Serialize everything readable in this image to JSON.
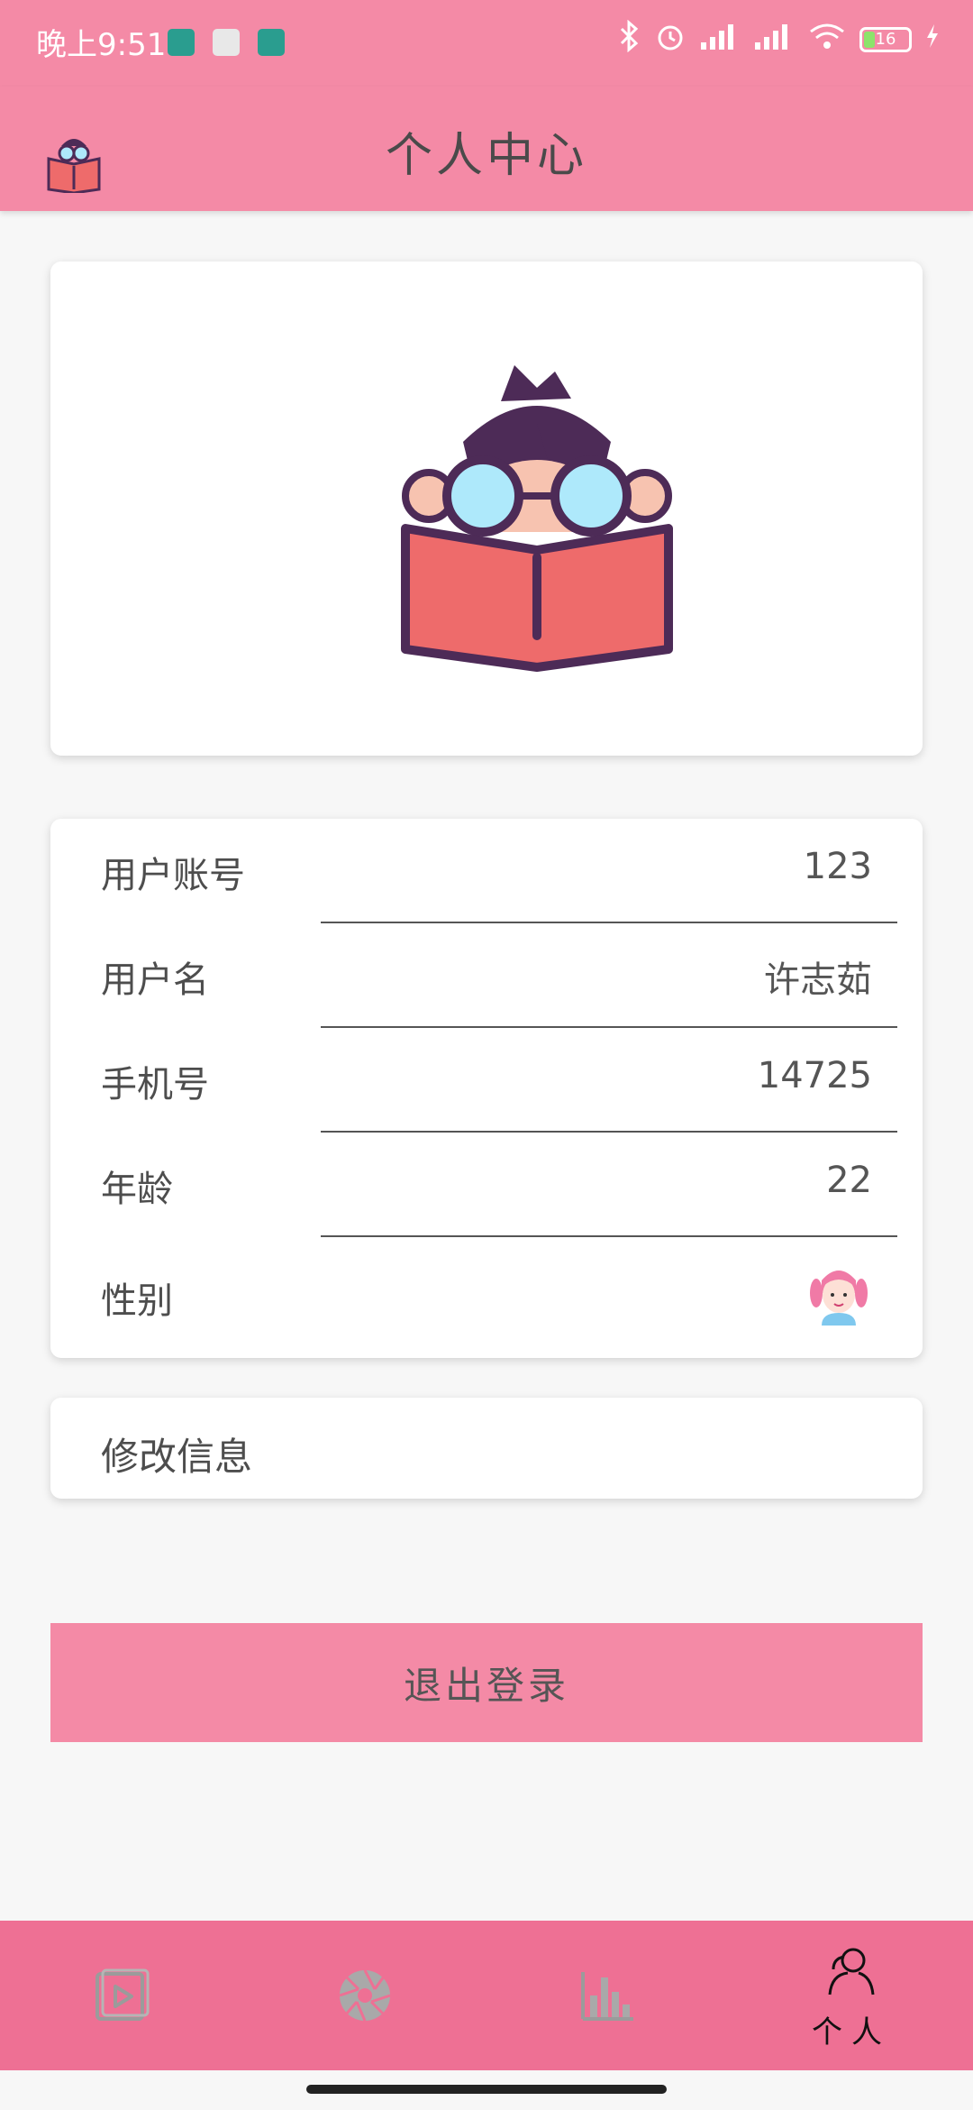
{
  "status_bar": {
    "time": "晚上9:51",
    "battery": "16"
  },
  "app_bar": {
    "title": "个人中心",
    "logo_icon": "reading-girl-logo"
  },
  "profile": {
    "avatar_icon": "reading-girl-avatar"
  },
  "info": {
    "rows": [
      {
        "label": "用户账号",
        "value": "123"
      },
      {
        "label": "用户名",
        "value": "许志茹"
      },
      {
        "label": "手机号",
        "value": "14725"
      },
      {
        "label": "年龄",
        "value": "22"
      }
    ],
    "gender_label": "性别",
    "gender_icon": "girl-icon"
  },
  "edit": {
    "label": "修改信息"
  },
  "logout": {
    "label": "退出登录"
  },
  "bottom_nav": {
    "items": [
      {
        "icon": "video-play-icon"
      },
      {
        "icon": "camera-aperture-icon"
      },
      {
        "icon": "bar-chart-icon"
      },
      {
        "icon": "person-icon",
        "label": "个人"
      }
    ]
  },
  "colors": {
    "accent": "#f48aa6",
    "nav": "#ee7094"
  }
}
